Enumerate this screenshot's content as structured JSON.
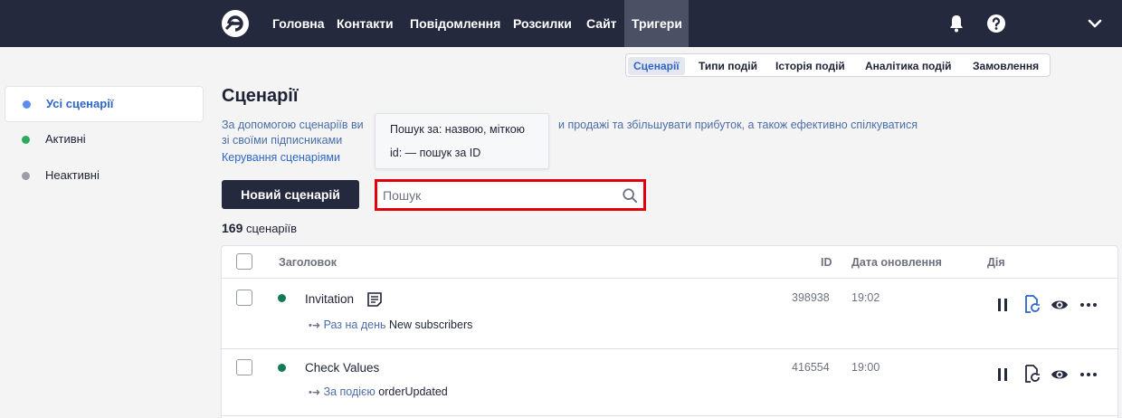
{
  "nav": {
    "items": [
      "Головна",
      "Контакти",
      "Повідомлення",
      "Розсилки",
      "Сайт",
      "Тригери"
    ],
    "active": "Тригери"
  },
  "subtabs": [
    "Сценарії",
    "Типи подій",
    "Історія подій",
    "Аналітика подій",
    "Замовлення"
  ],
  "sidebar": {
    "items": [
      {
        "label": "Усі сценарії",
        "dot_color": "#5b8def"
      },
      {
        "label": "Активні",
        "dot_color": "#2faa5c"
      },
      {
        "label": "Неактивні",
        "dot_color": "#9b9ea8"
      }
    ]
  },
  "main": {
    "title": "Сценарії",
    "desc_part1": "За допомогою сценаріїв ви",
    "desc_part2": "и продажі та збільшувати прибуток, а також ефективно спілкуватися",
    "desc_part3": "зі своїми підписниками",
    "manage_link": "Керування сценаріями",
    "new_button": "Новий сценарій",
    "search_placeholder": "Пошук",
    "tooltip_line1": "Пошук за: назвою, міткою",
    "tooltip_line2": "id: — пошук за ID",
    "count_number": "169",
    "count_label": "сценаріїв"
  },
  "table": {
    "headers": {
      "title": "Заголовок",
      "id": "ID",
      "date": "Дата оновлення",
      "action": "Дія"
    },
    "rows": [
      {
        "title": "Invitation",
        "trigger_label": "Раз на день",
        "trigger_value": "New subscribers",
        "id": "398938",
        "date": "19:02"
      },
      {
        "title": "Check Values",
        "trigger_label": "За подією",
        "trigger_value": "orderUpdated",
        "id": "416554",
        "date": "19:00"
      }
    ]
  },
  "colors": {
    "nav_bg": "#25293d",
    "accent": "#2f66c8",
    "highlight": "#e3000b",
    "active_status": "#137a52"
  }
}
